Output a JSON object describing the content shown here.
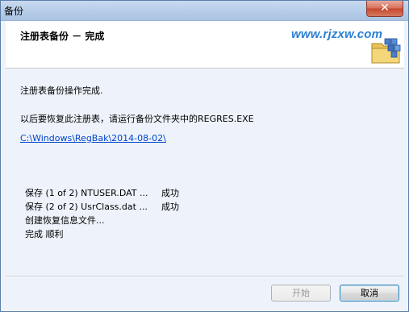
{
  "window": {
    "title": "备份",
    "close_label": "✕"
  },
  "header": {
    "title": "注册表备份 － 完成",
    "watermark": "www.rjzxw.com"
  },
  "content": {
    "status_message": "注册表备份操作完成.",
    "instruction": "以后要恢复此注册表，请运行备份文件夹中的REGRES.EXE",
    "backup_path_link": "C:\\Windows\\RegBak\\2014-08-02\\",
    "log": [
      {
        "text": "保存 (1 of 2) NTUSER.DAT ...",
        "status": "成功"
      },
      {
        "text": "保存 (2 of 2) UsrClass.dat ...",
        "status": "成功"
      },
      {
        "text": "创建恢复信息文件...",
        "status": ""
      },
      {
        "text": "完成 顺利",
        "status": ""
      }
    ]
  },
  "buttons": {
    "start_label": "开始",
    "cancel_label": "取消"
  }
}
